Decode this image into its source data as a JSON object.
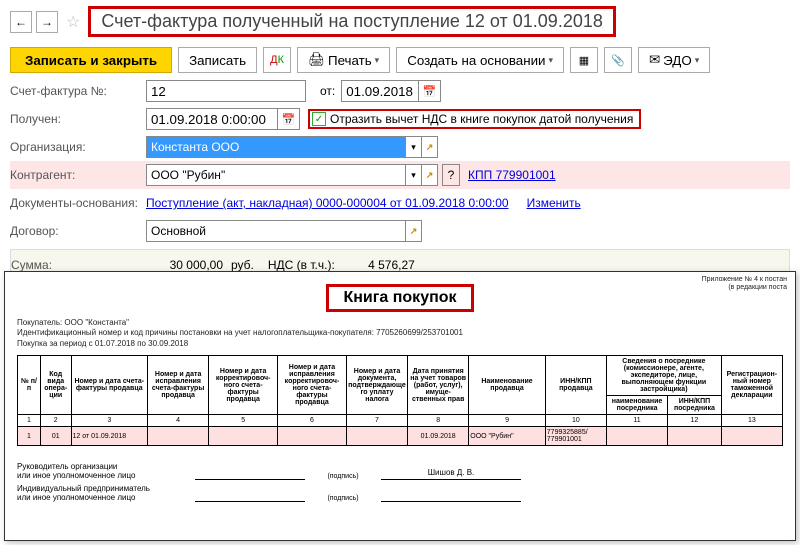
{
  "header": {
    "title": "Счет-фактура полученный на поступление 12 от 01.09.2018"
  },
  "toolbar": {
    "save_close": "Записать и закрыть",
    "save": "Записать",
    "print": "Печать",
    "create_based": "Создать на основании",
    "edo": "ЭДО"
  },
  "form": {
    "invoice_no_label": "Счет-фактура №:",
    "invoice_no": "12",
    "from_label": "от:",
    "from_date": "01.09.2018",
    "received_label": "Получен:",
    "received": "01.09.2018 0:00:00",
    "deduct_label": "Отразить вычет НДС в книге покупок датой получения",
    "org_label": "Организация:",
    "org": "Константа ООО",
    "agent_label": "Контрагент:",
    "agent": "ООО \"Рубин\"",
    "kpp": "КПП 779901001",
    "basis_label": "Документы-основания:",
    "basis_link": "Поступление (акт, накладная) 0000-000004 от 01.09.2018 0:00:00",
    "edit": "Изменить",
    "contract_label": "Договор:",
    "contract": "Основной",
    "sum_label": "Сумма:",
    "sum": "30 000,00",
    "currency": "руб.",
    "vat_label": "НДС (в т.ч.):",
    "vat": "4 576,27"
  },
  "book": {
    "right_note1": "Приложение № 4 к постан",
    "right_note2": "(в редакции поста",
    "title": "Книга покупок",
    "buyer": "Покупатель: ООО \"Константа\"",
    "inn_line": "Идентификационный номер и код причины постановки на учет налогоплательщика-покупателя: 7705260699/253701001",
    "period": "Покупка за период с 01.07.2018 по 30.09.2018",
    "cols": {
      "c1": "№ п/п",
      "c2": "Код вида опера-ции",
      "c3": "Номер и дата счета-фактуры продавца",
      "c4": "Номер и дата исправления счета-фактуры продавца",
      "c5": "Номер и дата корректировоч-ного счета-фактуры продавца",
      "c6": "Номер и дата исправления корректировоч-ного счета-фактуры продавца",
      "c7": "Номер и дата документа, подтверждающего уплату налога",
      "c8": "Дата принятия на учет товаров (работ, услуг), имуще-ственных прав",
      "c9": "Наименование продавца",
      "c10": "ИНН/КПП продавца",
      "c11_group": "Сведения о посреднике (комиссионере, агенте, экспедиторе, лице, выполняющем функции застройщика)",
      "c11": "наименование посредника",
      "c12": "ИНН/КПП посредника",
      "c13": "Регистрацион-ный номер таможенной декларации"
    },
    "nums": [
      "1",
      "2",
      "3",
      "4",
      "5",
      "6",
      "7",
      "8",
      "9",
      "10",
      "11",
      "12",
      "13"
    ],
    "row": {
      "n": "1",
      "op": "01",
      "sf": "12 от 01.09.2018",
      "date_acc": "01.09.2018",
      "seller": "ООО \"Рубин\"",
      "inn": "7799325885/ 779901001"
    },
    "sign1": "Руководитель организации",
    "sign1b": "или иное уполномоченное лицо",
    "sign_tag": "(подпись)",
    "sign_name": "Шишов Д. В.",
    "sign2": "Индивидуальный предприниматель",
    "sign2b": "или иное уполномоченное лицо"
  }
}
